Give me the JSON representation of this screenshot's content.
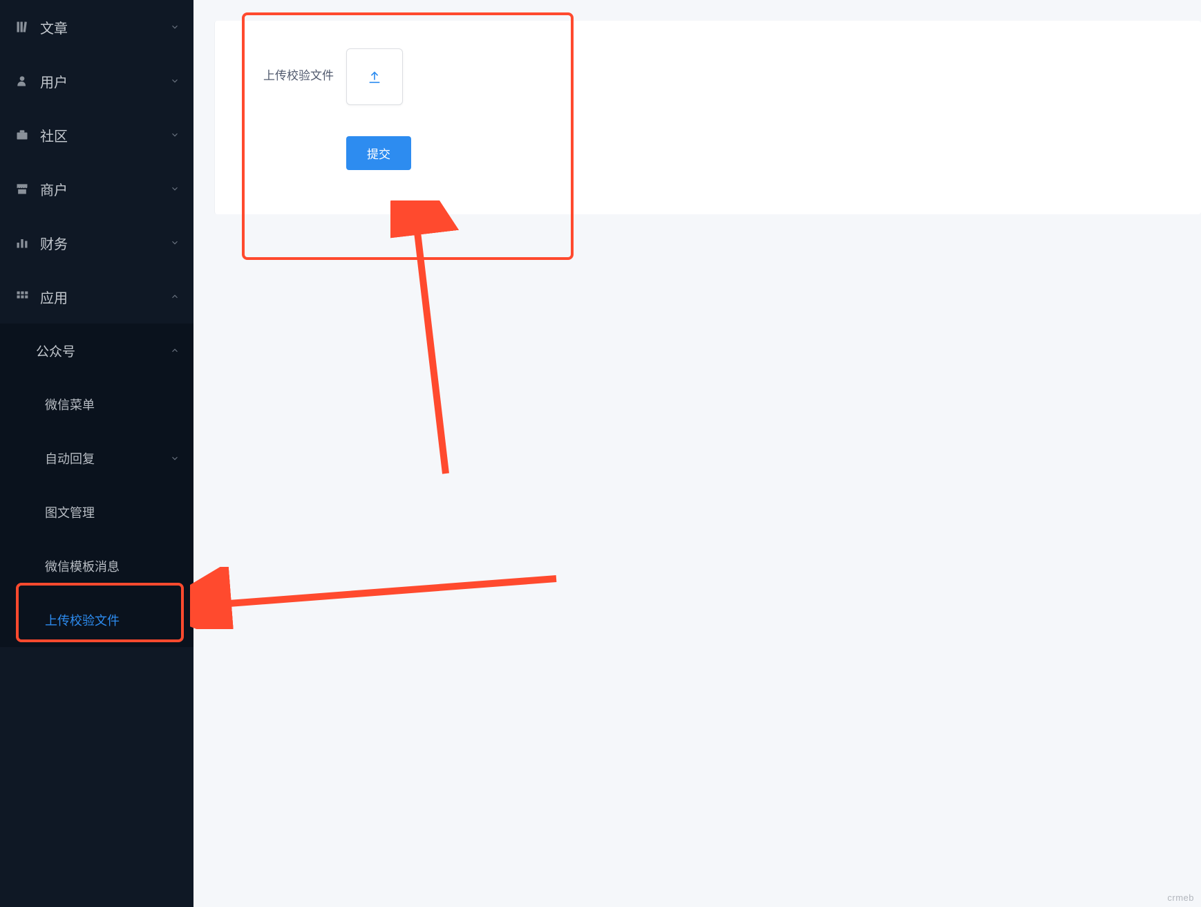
{
  "sidebar": {
    "items": [
      {
        "label": "文章",
        "icon": "book"
      },
      {
        "label": "用户",
        "icon": "user"
      },
      {
        "label": "社区",
        "icon": "briefcase"
      },
      {
        "label": "商户",
        "icon": "store"
      },
      {
        "label": "财务",
        "icon": "chart"
      },
      {
        "label": "应用",
        "icon": "grid",
        "expanded": true
      }
    ],
    "subsection": {
      "header": "公众号",
      "items": [
        {
          "label": "微信菜单"
        },
        {
          "label": "自动回复",
          "has_children": true
        },
        {
          "label": "图文管理"
        },
        {
          "label": "微信模板消息"
        },
        {
          "label": "上传校验文件",
          "active": true
        }
      ]
    }
  },
  "form": {
    "upload_label": "上传校验文件",
    "submit_label": "提交"
  },
  "watermark": "crmeb"
}
